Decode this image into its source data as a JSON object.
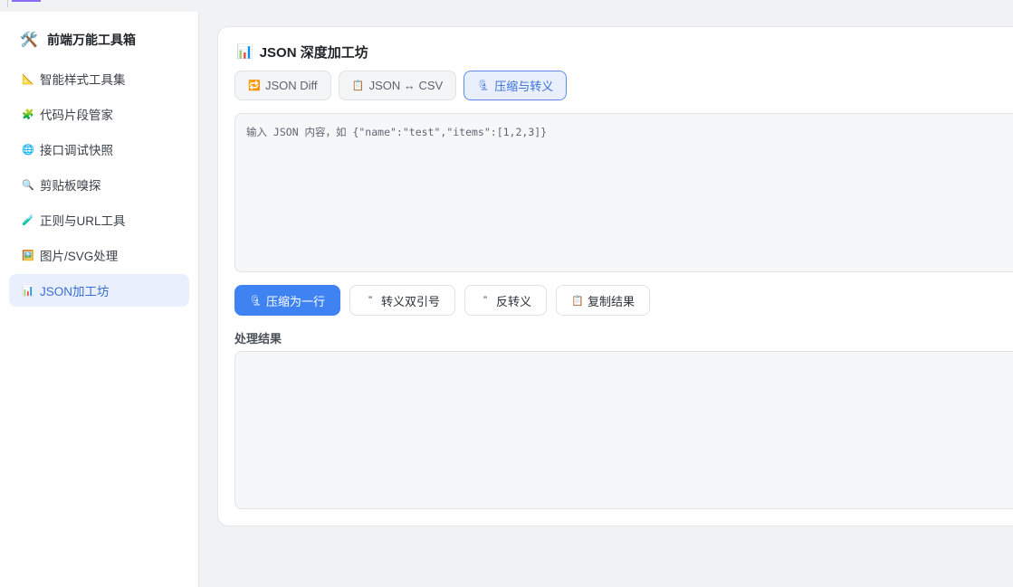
{
  "brand": {
    "icon": "🛠️",
    "title": "前端万能工具箱"
  },
  "sidebar": {
    "items": [
      {
        "icon": "📐",
        "label": "智能样式工具集",
        "active": false
      },
      {
        "icon": "🧩",
        "label": "代码片段管家",
        "active": false
      },
      {
        "icon": "🌐",
        "label": "接口调试快照",
        "active": false
      },
      {
        "icon": "🔍",
        "label": "剪贴板嗅探",
        "active": false
      },
      {
        "icon": "🧪",
        "label": "正则与URL工具",
        "active": false
      },
      {
        "icon": "🖼️",
        "label": "图片/SVG处理",
        "active": false
      },
      {
        "icon": "📊",
        "label": "JSON加工坊",
        "active": true
      }
    ]
  },
  "main": {
    "title_icon": "📊",
    "title": "JSON 深度加工坊",
    "tabs": [
      {
        "icon": "🔁",
        "label": "JSON Diff",
        "active": false
      },
      {
        "icon": "📋",
        "label": "JSON ↔ CSV",
        "active": false
      },
      {
        "icon": "🗜",
        "label": "压缩与转义",
        "active": true
      }
    ],
    "input": {
      "value": "",
      "placeholder": "输入 JSON 内容，如 {\"name\":\"test\",\"items\":[1,2,3]}"
    },
    "actions": [
      {
        "icon": "🗜",
        "label": "压缩为一行",
        "primary": true
      },
      {
        "icon": "\"",
        "label": "转义双引号",
        "primary": false
      },
      {
        "icon": "\"",
        "label": "反转义",
        "primary": false
      },
      {
        "icon": "📋",
        "label": "复制结果",
        "primary": false
      }
    ],
    "result_label": "处理结果",
    "result": {
      "value": ""
    }
  }
}
